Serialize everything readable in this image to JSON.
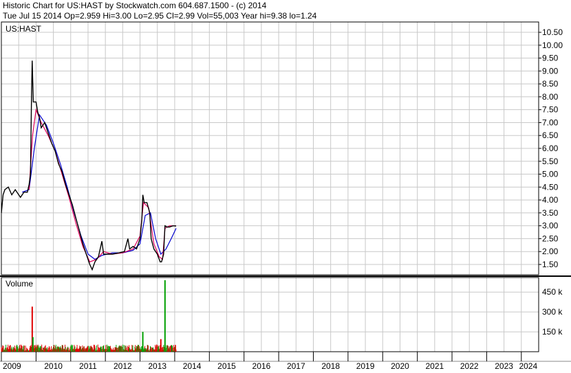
{
  "header": {
    "line1": "Historic Chart for US:HAST by Stockwatch.com 604.687.1500 - (c) 2014",
    "line2": "Tue Jul 15 2014   Op=2.959  Hi=3.00  Lo=2.95  Cl=2.99  Vol=55,003  Year hi=9.38  lo=1.24"
  },
  "chart_data": [
    {
      "type": "line",
      "title": "US:HAST",
      "panel": "price",
      "x_unit": "year",
      "xlim": [
        2009,
        2024.5
      ],
      "ylim": [
        1.1,
        10.9
      ],
      "y_ticks": [
        "1.50",
        "2.00",
        "2.50",
        "3.00",
        "3.50",
        "4.00",
        "4.50",
        "5.00",
        "5.50",
        "6.00",
        "6.50",
        "7.00",
        "7.50",
        "8.00",
        "8.50",
        "9.00",
        "9.50",
        "10.00",
        "10.50"
      ],
      "x_ticks": [
        "2009",
        "2010",
        "2011",
        "2012",
        "2013",
        "2014",
        "2015",
        "2016",
        "2017",
        "2018",
        "2019",
        "2020",
        "2021",
        "2022",
        "2023",
        "2024"
      ],
      "grid": true,
      "colors": {
        "price": "#000000",
        "ma_fast": "#e0005a",
        "ma_slow": "#0000cc",
        "grid": "#c8c8c8"
      },
      "series": [
        {
          "role": "price",
          "points": [
            [
              2009.0,
              3.5
            ],
            [
              2009.05,
              4.2
            ],
            [
              2009.1,
              4.4
            ],
            [
              2009.2,
              4.5
            ],
            [
              2009.3,
              4.2
            ],
            [
              2009.4,
              4.4
            ],
            [
              2009.55,
              4.1
            ],
            [
              2009.65,
              4.3
            ],
            [
              2009.75,
              4.3
            ],
            [
              2009.8,
              4.6
            ],
            [
              2009.84,
              5.0
            ],
            [
              2009.87,
              8.0
            ],
            [
              2009.89,
              9.4
            ],
            [
              2009.92,
              7.8
            ],
            [
              2010.0,
              7.8
            ],
            [
              2010.05,
              7.4
            ],
            [
              2010.1,
              7.2
            ],
            [
              2010.15,
              6.8
            ],
            [
              2010.25,
              7.0
            ],
            [
              2010.35,
              6.6
            ],
            [
              2010.45,
              6.2
            ],
            [
              2010.55,
              5.9
            ],
            [
              2010.65,
              5.4
            ],
            [
              2010.75,
              5.1
            ],
            [
              2010.85,
              4.6
            ],
            [
              2010.95,
              4.2
            ],
            [
              2011.05,
              3.8
            ],
            [
              2011.15,
              3.3
            ],
            [
              2011.25,
              2.8
            ],
            [
              2011.35,
              2.3
            ],
            [
              2011.45,
              1.9
            ],
            [
              2011.55,
              1.5
            ],
            [
              2011.62,
              1.3
            ],
            [
              2011.7,
              1.6
            ],
            [
              2011.8,
              1.8
            ],
            [
              2011.9,
              2.4
            ],
            [
              2011.95,
              1.9
            ],
            [
              2012.05,
              1.9
            ],
            [
              2012.2,
              1.9
            ],
            [
              2012.4,
              1.95
            ],
            [
              2012.55,
              2.0
            ],
            [
              2012.65,
              2.5
            ],
            [
              2012.7,
              2.1
            ],
            [
              2012.8,
              2.2
            ],
            [
              2012.9,
              2.1
            ],
            [
              2013.0,
              2.5
            ],
            [
              2013.05,
              3.2
            ],
            [
              2013.08,
              4.2
            ],
            [
              2013.12,
              3.9
            ],
            [
              2013.2,
              3.9
            ],
            [
              2013.28,
              3.5
            ],
            [
              2013.32,
              2.5
            ],
            [
              2013.4,
              2.1
            ],
            [
              2013.5,
              1.9
            ],
            [
              2013.58,
              1.6
            ],
            [
              2013.62,
              1.6
            ],
            [
              2013.68,
              1.9
            ],
            [
              2013.72,
              3.0
            ],
            [
              2013.78,
              2.95
            ],
            [
              2013.85,
              2.95
            ],
            [
              2013.95,
              3.0
            ],
            [
              2014.04,
              2.99
            ]
          ]
        },
        {
          "role": "ma_fast",
          "points": [
            [
              2009.8,
              4.4
            ],
            [
              2009.9,
              6.5
            ],
            [
              2010.0,
              7.5
            ],
            [
              2010.15,
              7.0
            ],
            [
              2010.35,
              6.5
            ],
            [
              2010.55,
              5.9
            ],
            [
              2010.75,
              5.0
            ],
            [
              2010.95,
              4.1
            ],
            [
              2011.15,
              3.1
            ],
            [
              2011.35,
              2.2
            ],
            [
              2011.55,
              1.6
            ],
            [
              2011.75,
              1.7
            ],
            [
              2011.95,
              2.0
            ],
            [
              2012.2,
              1.9
            ],
            [
              2012.5,
              1.95
            ],
            [
              2012.8,
              2.1
            ],
            [
              2013.0,
              2.6
            ],
            [
              2013.1,
              3.9
            ],
            [
              2013.25,
              3.7
            ],
            [
              2013.4,
              2.3
            ],
            [
              2013.55,
              1.8
            ],
            [
              2013.65,
              1.7
            ],
            [
              2013.72,
              2.9
            ],
            [
              2013.85,
              3.0
            ],
            [
              2014.04,
              3.0
            ]
          ]
        },
        {
          "role": "ma_slow",
          "points": [
            [
              2009.6,
              4.3
            ],
            [
              2009.8,
              4.4
            ],
            [
              2009.95,
              6.0
            ],
            [
              2010.1,
              7.3
            ],
            [
              2010.3,
              6.9
            ],
            [
              2010.5,
              6.2
            ],
            [
              2010.7,
              5.4
            ],
            [
              2010.9,
              4.5
            ],
            [
              2011.1,
              3.5
            ],
            [
              2011.3,
              2.6
            ],
            [
              2011.5,
              1.9
            ],
            [
              2011.7,
              1.7
            ],
            [
              2011.9,
              1.85
            ],
            [
              2012.2,
              1.95
            ],
            [
              2012.5,
              1.95
            ],
            [
              2012.8,
              2.05
            ],
            [
              2013.0,
              2.3
            ],
            [
              2013.15,
              3.4
            ],
            [
              2013.3,
              3.5
            ],
            [
              2013.45,
              2.5
            ],
            [
              2013.6,
              1.9
            ],
            [
              2013.75,
              2.1
            ],
            [
              2013.9,
              2.5
            ],
            [
              2014.04,
              2.9
            ]
          ]
        }
      ]
    },
    {
      "type": "bar",
      "title": "Volume",
      "panel": "volume",
      "x_unit": "year",
      "xlim": [
        2009,
        2024.5
      ],
      "ylim": [
        0,
        560000
      ],
      "y_ticks": [
        "150 k",
        "300 k",
        "450 k"
      ],
      "y_tick_values": [
        150000,
        300000,
        450000
      ],
      "colors": {
        "up": "#00a000",
        "down": "#e00000"
      },
      "spikes": [
        {
          "x": 2009.89,
          "value": 340000,
          "dir": "down"
        },
        {
          "x": 2009.91,
          "value": 110000,
          "dir": "up"
        },
        {
          "x": 2013.08,
          "value": 150000,
          "dir": "up"
        },
        {
          "x": 2013.6,
          "value": 95000,
          "dir": "down"
        },
        {
          "x": 2013.72,
          "value": 540000,
          "dir": "up"
        }
      ],
      "baseline_volume": 30000
    }
  ]
}
